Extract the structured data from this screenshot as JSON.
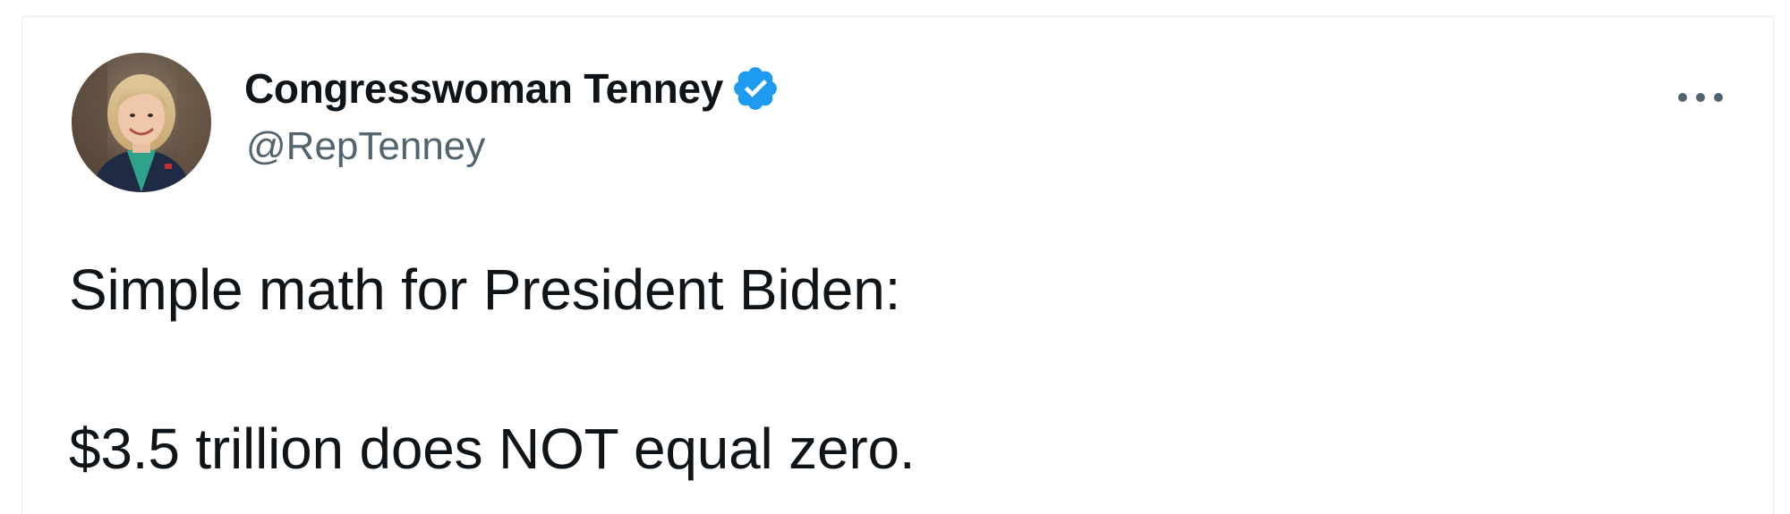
{
  "tweet": {
    "author": {
      "display_name": "Congresswoman Tenney",
      "handle": "@RepTenney",
      "verified": true,
      "avatar_icon": "profile-photo"
    },
    "body_lines": [
      "Simple math for President Biden:",
      "$3.5 trillion does NOT equal zero."
    ],
    "more_icon": "more-options-icon"
  },
  "colors": {
    "text_primary": "#0f1419",
    "text_secondary": "#536471",
    "verified_blue": "#1d9bf0",
    "border": "#e6ecf0"
  }
}
